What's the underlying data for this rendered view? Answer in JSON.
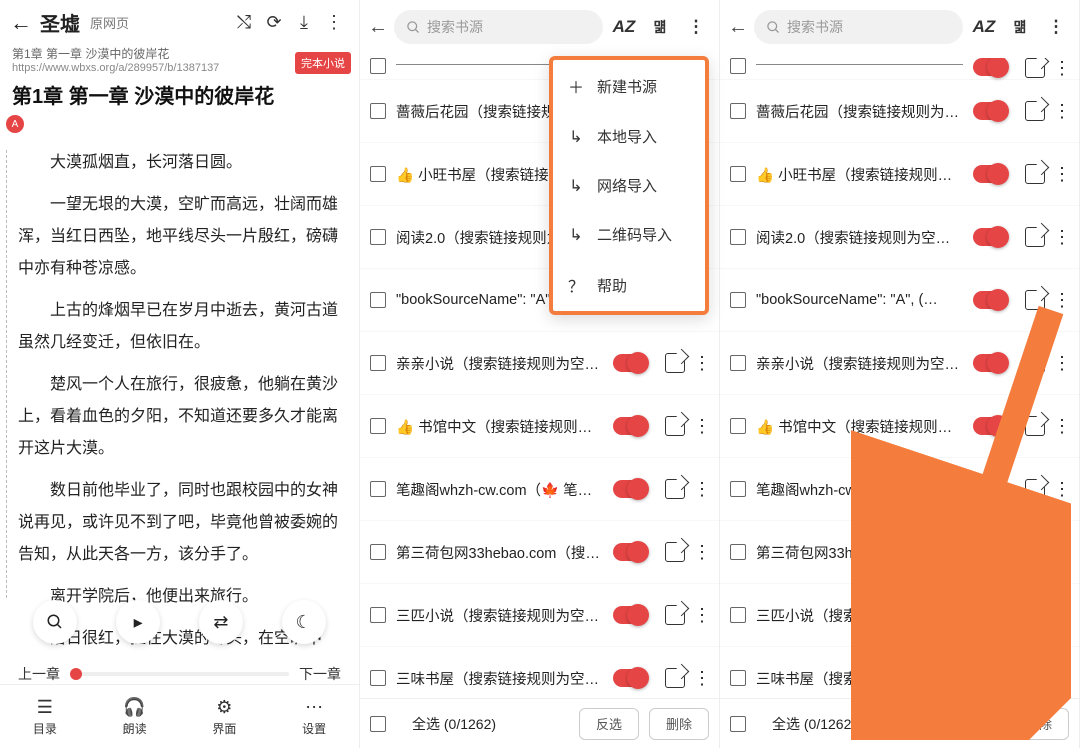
{
  "reader": {
    "title": "圣墟",
    "origin_label": "原网页",
    "chapter_meta": "第1章 第一章 沙漠中的彼岸花",
    "url": "https://www.wbxs.org/a/289957/b/1387137",
    "finish_badge": "完本小说",
    "chapter_title": "第1章 第一章 沙漠中的彼岸花",
    "marker": "A",
    "paragraphs": [
      "大漠孤烟直，长河落日圆。",
      "一望无垠的大漠，空旷而高远，壮阔而雄浑，当红日西坠，地平线尽头一片殷红，磅礴中亦有种苍凉感。",
      "上古的烽烟早已在岁月中逝去，黄河古道虽然几经变迁，但依旧在。",
      "楚风一个人在旅行，很疲惫，他躺在黄沙上，看着血色的夕阳，不知道还要多久才能离开这片大漠。",
      "数日前他毕业了，同时也跟校园中的女神说再见，或许见不到了吧，毕竟他曾被委婉的告知，从此天各一方，该分手了。",
      "离开学院后，他便出来旅行。",
      "落日很红，挂在大漠的尽头，在空旷中"
    ],
    "pager": {
      "prev": "上一章",
      "next": "下一章"
    },
    "bottom": {
      "toc": "目录",
      "read": "朗读",
      "ui": "界面",
      "set": "设置"
    }
  },
  "bs": {
    "search_placeholder": "搜索书源",
    "az": "AZ",
    "items": [
      {
        "label": "蔷薇后花园（搜索链接规则为…",
        "emoji": ""
      },
      {
        "label": "小旺书屋（搜索链接规则为…",
        "emoji": "👍"
      },
      {
        "label": "阅读2.0（搜索链接规则为空，…",
        "emoji": ""
      },
      {
        "label": "\"bookSourceName\": \"A\", (…",
        "emoji": ""
      },
      {
        "label": "亲亲小说（搜索链接规则为空，…",
        "emoji": ""
      },
      {
        "label": "书馆中文（搜索链接规则为…",
        "emoji": "👍"
      },
      {
        "label": "笔趣阁whzh-cw.com（🍁 笔…",
        "emoji": ""
      },
      {
        "label": "第三荷包网33hebao.com（搜…",
        "emoji": ""
      },
      {
        "label": "三匹小说（搜索链接规则为空，…",
        "emoji": ""
      },
      {
        "label": "三味书屋（搜索链接规则为空，…",
        "emoji": ""
      }
    ],
    "footer": {
      "select_all": "全选 (0/1262)",
      "invert": "反选",
      "delete": "删除"
    }
  },
  "menu": {
    "new": "新建书源",
    "local": "本地导入",
    "net": "网络导入",
    "qr": "二维码导入",
    "help": "帮助"
  }
}
